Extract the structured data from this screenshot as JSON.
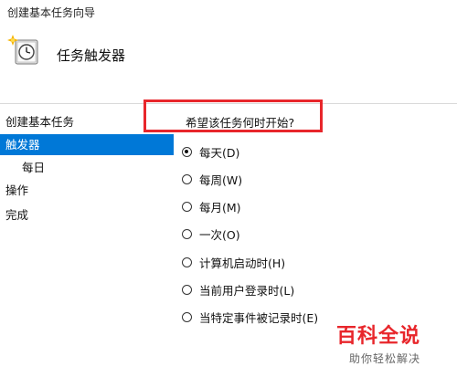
{
  "window": {
    "title": "创建基本任务向导"
  },
  "header": {
    "title": "任务触发器",
    "icon": "task-clock-icon"
  },
  "sidebar": {
    "items": [
      {
        "label": "创建基本任务",
        "selected": false,
        "sub": false
      },
      {
        "label": "触发器",
        "selected": true,
        "sub": false
      },
      {
        "label": "每日",
        "selected": false,
        "sub": true
      },
      {
        "label": "操作",
        "selected": false,
        "sub": false
      },
      {
        "label": "完成",
        "selected": false,
        "sub": false
      }
    ]
  },
  "main": {
    "question": "希望该任务何时开始?",
    "options": [
      {
        "label": "每天(D)",
        "checked": true
      },
      {
        "label": "每周(W)",
        "checked": false
      },
      {
        "label": "每月(M)",
        "checked": false
      },
      {
        "label": "一次(O)",
        "checked": false
      },
      {
        "label": "计算机启动时(H)",
        "checked": false
      },
      {
        "label": "当前用户登录时(L)",
        "checked": false
      },
      {
        "label": "当特定事件被记录时(E)",
        "checked": false
      }
    ]
  },
  "watermark": {
    "logo": "百科全说",
    "tagline": "助你轻松解决"
  },
  "colors": {
    "accent": "#0078d7",
    "highlight": "#e8262b"
  }
}
